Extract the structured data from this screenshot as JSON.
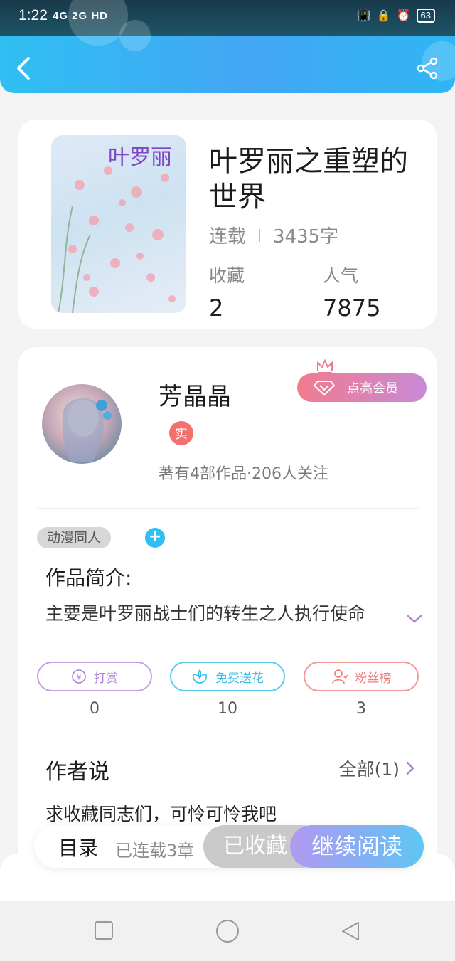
{
  "status_bar": {
    "time": "1:22",
    "network": "4G 2G HD",
    "battery": "63"
  },
  "header": {
    "back_icon": "chevron-left-icon",
    "share_icon": "share-icon"
  },
  "book": {
    "cover_title": "叶罗丽",
    "title": "叶罗丽之重塑的世界",
    "status": "连载",
    "word_count": "3435字",
    "favorites_label": "收藏",
    "favorites_value": "2",
    "popularity_label": "人气",
    "popularity_value": "7875"
  },
  "author": {
    "name": "芳晶晶",
    "vip_label": "点亮会员",
    "real_badge": "实",
    "stats": "著有4部作品·206人关注"
  },
  "work": {
    "tag": "动漫同人",
    "tag_add": "+",
    "intro_label": "作品简介:",
    "intro_text": "主要是叶罗丽战士们的转生之人执行使命"
  },
  "actions": [
    {
      "label": "打赏",
      "count": "0",
      "color": "#b07fd6",
      "icon": "yen-coin-icon"
    },
    {
      "label": "免费送花",
      "count": "10",
      "color": "#36bde5",
      "icon": "flower-icon"
    },
    {
      "label": "粉丝榜",
      "count": "3",
      "color": "#f07a7a",
      "icon": "fan-user-icon"
    }
  ],
  "author_says": {
    "title": "作者说",
    "all_link": "全部(1)",
    "message": "求收藏同志们，可怜可怜我吧"
  },
  "bottom_bar": {
    "toc": "目录",
    "chapters": "已连载3章",
    "collected": "已收藏",
    "continue": "继续阅读"
  },
  "nav_bar": {
    "recent_icon": "square-icon",
    "home_icon": "circle-icon",
    "back_icon": "triangle-back-icon"
  }
}
